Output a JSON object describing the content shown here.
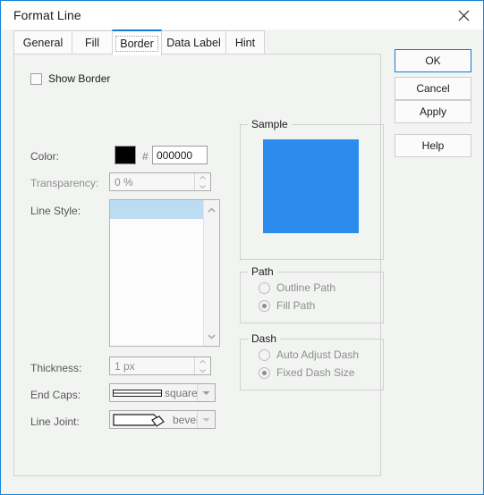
{
  "window": {
    "title": "Format Line",
    "close_icon": "close-icon"
  },
  "tabs": [
    {
      "label": "General",
      "active": false
    },
    {
      "label": "Fill",
      "active": false
    },
    {
      "label": "Border",
      "active": true
    },
    {
      "label": "Data Label",
      "active": false
    },
    {
      "label": "Hint",
      "active": false
    }
  ],
  "border_tab": {
    "show_border": {
      "label": "Show Border",
      "checked": false
    },
    "color": {
      "label": "Color:",
      "swatch_hex": "#000000",
      "hash_symbol": "#",
      "hex_value": "000000"
    },
    "transparency": {
      "label": "Transparency:",
      "value": "0 %",
      "enabled": false
    },
    "line_style": {
      "label": "Line Style:",
      "selected_index": 0,
      "items": [
        ""
      ]
    },
    "thickness": {
      "label": "Thickness:",
      "value": "1 px",
      "enabled": false
    },
    "end_caps": {
      "label": "End Caps:",
      "value": "square"
    },
    "line_joint": {
      "label": "Line Joint:",
      "value": "bevel"
    },
    "sample": {
      "title": "Sample",
      "fill_color": "#2b8cee"
    },
    "path": {
      "title": "Path",
      "options": [
        {
          "label": "Outline Path",
          "selected": false
        },
        {
          "label": "Fill Path",
          "selected": true
        }
      ]
    },
    "dash": {
      "title": "Dash",
      "options": [
        {
          "label": "Auto Adjust Dash",
          "selected": false
        },
        {
          "label": "Fixed Dash Size",
          "selected": true
        }
      ]
    }
  },
  "buttons": [
    {
      "label": "OK",
      "default": true
    },
    {
      "label": "Cancel",
      "default": false
    },
    {
      "label": "Apply",
      "default": false
    },
    {
      "label": "Help",
      "default": false
    }
  ],
  "colors": {
    "accent": "#0f7bd4",
    "sample_blue": "#2b8cee",
    "selection_blue": "#bcdcf2"
  }
}
